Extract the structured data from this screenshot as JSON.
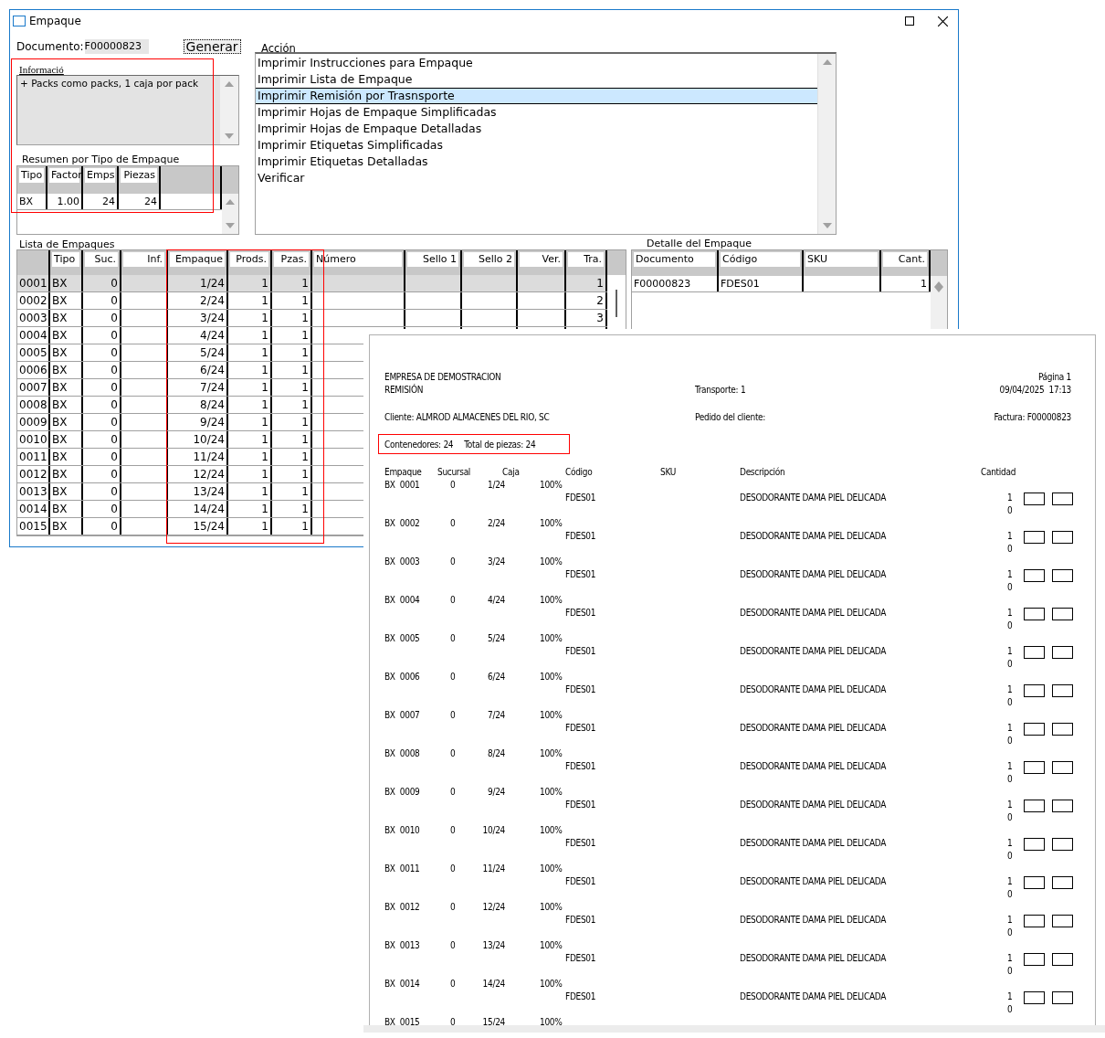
{
  "window": {
    "title": "Empaque"
  },
  "documento": {
    "label": "Documento:",
    "value": "F00000823"
  },
  "generar_button": {
    "label": "Generar",
    "focused": true
  },
  "informacion": {
    "label": "Informació",
    "text": "+ Packs como packs, 1 caja por pack"
  },
  "resumen": {
    "title": "Resumen por Tipo de Empaque",
    "columns": [
      "Tipo",
      "Factor",
      "Emps",
      "Piezas"
    ],
    "rows": [
      [
        "BX",
        "1.00",
        "24",
        "24"
      ]
    ]
  },
  "accion": {
    "label": "Acción",
    "items": [
      {
        "label": "Imprimir Instrucciones para Empaque",
        "selected": false
      },
      {
        "label": "Imprimir Lista de Empaque",
        "selected": false
      },
      {
        "label": "Imprimir Remisión por Trasnsporte",
        "selected": true
      },
      {
        "label": "Imprimir Hojas de Empaque Simplificadas",
        "selected": false
      },
      {
        "label": "Imprimir Hojas de Empaque Detalladas",
        "selected": false
      },
      {
        "label": "Imprimir Etiquetas Simplificadas",
        "selected": false
      },
      {
        "label": "Imprimir Etiquetas Detalladas",
        "selected": false
      },
      {
        "label": "Verificar",
        "selected": false
      }
    ]
  },
  "lista": {
    "title": "Lista de Empaques",
    "columns": [
      "Tipo",
      "Suc.",
      "Inf.",
      "Empaque",
      "Prods.",
      "Pzas.",
      "Número",
      "Sello 1",
      "Sello 2",
      "Ver.",
      "Tra."
    ],
    "rows": [
      {
        "num": "0001",
        "tipo": "BX",
        "suc": "0",
        "empaque": "1/24",
        "prods": "1",
        "pzas": "1",
        "tra": "1",
        "selected": true
      },
      {
        "num": "0002",
        "tipo": "BX",
        "suc": "0",
        "empaque": "2/24",
        "prods": "1",
        "pzas": "1",
        "tra": "2",
        "selected": false
      },
      {
        "num": "0003",
        "tipo": "BX",
        "suc": "0",
        "empaque": "3/24",
        "prods": "1",
        "pzas": "1",
        "tra": "3",
        "selected": false
      },
      {
        "num": "0004",
        "tipo": "BX",
        "suc": "0",
        "empaque": "4/24",
        "prods": "1",
        "pzas": "1",
        "selected": false
      },
      {
        "num": "0005",
        "tipo": "BX",
        "suc": "0",
        "empaque": "5/24",
        "prods": "1",
        "pzas": "1",
        "selected": false
      },
      {
        "num": "0006",
        "tipo": "BX",
        "suc": "0",
        "empaque": "6/24",
        "prods": "1",
        "pzas": "1",
        "selected": false
      },
      {
        "num": "0007",
        "tipo": "BX",
        "suc": "0",
        "empaque": "7/24",
        "prods": "1",
        "pzas": "1",
        "selected": false
      },
      {
        "num": "0008",
        "tipo": "BX",
        "suc": "0",
        "empaque": "8/24",
        "prods": "1",
        "pzas": "1",
        "selected": false
      },
      {
        "num": "0009",
        "tipo": "BX",
        "suc": "0",
        "empaque": "9/24",
        "prods": "1",
        "pzas": "1",
        "selected": false
      },
      {
        "num": "0010",
        "tipo": "BX",
        "suc": "0",
        "empaque": "10/24",
        "prods": "1",
        "pzas": "1",
        "selected": false
      },
      {
        "num": "0011",
        "tipo": "BX",
        "suc": "0",
        "empaque": "11/24",
        "prods": "1",
        "pzas": "1",
        "selected": false
      },
      {
        "num": "0012",
        "tipo": "BX",
        "suc": "0",
        "empaque": "12/24",
        "prods": "1",
        "pzas": "1",
        "selected": false
      },
      {
        "num": "0013",
        "tipo": "BX",
        "suc": "0",
        "empaque": "13/24",
        "prods": "1",
        "pzas": "1",
        "selected": false
      },
      {
        "num": "0014",
        "tipo": "BX",
        "suc": "0",
        "empaque": "14/24",
        "prods": "1",
        "pzas": "1",
        "selected": false
      },
      {
        "num": "0015",
        "tipo": "BX",
        "suc": "0",
        "empaque": "15/24",
        "prods": "1",
        "pzas": "1",
        "selected": false
      }
    ]
  },
  "detalle": {
    "title": "Detalle del Empaque",
    "columns": [
      "Documento",
      "Código",
      "SKU",
      "Cant."
    ],
    "rows": [
      [
        "F00000823",
        "FDES01",
        "",
        "1"
      ]
    ]
  },
  "report": {
    "company": "EMPRESA DE DEMOSTRACION",
    "doc_type": "REMISIÓN",
    "transporte": "Transporte: 1",
    "page": "Página 1",
    "datetime": "09/04/2025  17:13",
    "cliente": "Cliente: ALMROD  ALMACENES DEL RIO, SC",
    "pedido": "Pedido del cliente:",
    "factura": "Factura: F00000823",
    "contenedores": "Contenedores: 24",
    "total_piezas": "Total de piezas: 24",
    "columns": [
      "Empaque",
      "Sucursal",
      "Caja",
      "Código",
      "SKU",
      "Descripción",
      "Cantidad"
    ],
    "entries": [
      {
        "empaque": "BX  0001",
        "sucursal": "0",
        "caja": "1/24",
        "percent": "100%",
        "codigo": "FDES01",
        "descripcion": "DESODORANTE DAMA PIEL DELICADA",
        "cantidad": "1",
        "extra": "0"
      },
      {
        "empaque": "BX  0002",
        "sucursal": "0",
        "caja": "2/24",
        "percent": "100%",
        "codigo": "FDES01",
        "descripcion": "DESODORANTE DAMA PIEL DELICADA",
        "cantidad": "1",
        "extra": "0"
      },
      {
        "empaque": "BX  0003",
        "sucursal": "0",
        "caja": "3/24",
        "percent": "100%",
        "codigo": "FDES01",
        "descripcion": "DESODORANTE DAMA PIEL DELICADA",
        "cantidad": "1",
        "extra": "0"
      },
      {
        "empaque": "BX  0004",
        "sucursal": "0",
        "caja": "4/24",
        "percent": "100%",
        "codigo": "FDES01",
        "descripcion": "DESODORANTE DAMA PIEL DELICADA",
        "cantidad": "1",
        "extra": "0"
      },
      {
        "empaque": "BX  0005",
        "sucursal": "0",
        "caja": "5/24",
        "percent": "100%",
        "codigo": "FDES01",
        "descripcion": "DESODORANTE DAMA PIEL DELICADA",
        "cantidad": "1",
        "extra": "0"
      },
      {
        "empaque": "BX  0006",
        "sucursal": "0",
        "caja": "6/24",
        "percent": "100%",
        "codigo": "FDES01",
        "descripcion": "DESODORANTE DAMA PIEL DELICADA",
        "cantidad": "1",
        "extra": "0"
      },
      {
        "empaque": "BX  0007",
        "sucursal": "0",
        "caja": "7/24",
        "percent": "100%",
        "codigo": "FDES01",
        "descripcion": "DESODORANTE DAMA PIEL DELICADA",
        "cantidad": "1",
        "extra": "0"
      },
      {
        "empaque": "BX  0008",
        "sucursal": "0",
        "caja": "8/24",
        "percent": "100%",
        "codigo": "FDES01",
        "descripcion": "DESODORANTE DAMA PIEL DELICADA",
        "cantidad": "1",
        "extra": "0"
      },
      {
        "empaque": "BX  0009",
        "sucursal": "0",
        "caja": "9/24",
        "percent": "100%",
        "codigo": "FDES01",
        "descripcion": "DESODORANTE DAMA PIEL DELICADA",
        "cantidad": "1",
        "extra": "0"
      },
      {
        "empaque": "BX  0010",
        "sucursal": "0",
        "caja": "10/24",
        "percent": "100%",
        "codigo": "FDES01",
        "descripcion": "DESODORANTE DAMA PIEL DELICADA",
        "cantidad": "1",
        "extra": "0"
      },
      {
        "empaque": "BX  0011",
        "sucursal": "0",
        "caja": "11/24",
        "percent": "100%",
        "codigo": "FDES01",
        "descripcion": "DESODORANTE DAMA PIEL DELICADA",
        "cantidad": "1",
        "extra": "0"
      },
      {
        "empaque": "BX  0012",
        "sucursal": "0",
        "caja": "12/24",
        "percent": "100%",
        "codigo": "FDES01",
        "descripcion": "DESODORANTE DAMA PIEL DELICADA",
        "cantidad": "1",
        "extra": "0"
      },
      {
        "empaque": "BX  0013",
        "sucursal": "0",
        "caja": "13/24",
        "percent": "100%",
        "codigo": "FDES01",
        "descripcion": "DESODORANTE DAMA PIEL DELICADA",
        "cantidad": "1",
        "extra": "0"
      },
      {
        "empaque": "BX  0014",
        "sucursal": "0",
        "caja": "14/24",
        "percent": "100%",
        "codigo": "FDES01",
        "descripcion": "DESODORANTE DAMA PIEL DELICADA",
        "cantidad": "1",
        "extra": "0"
      },
      {
        "empaque": "BX  0015",
        "sucursal": "0",
        "caja": "15/24",
        "percent": "100%"
      }
    ]
  }
}
